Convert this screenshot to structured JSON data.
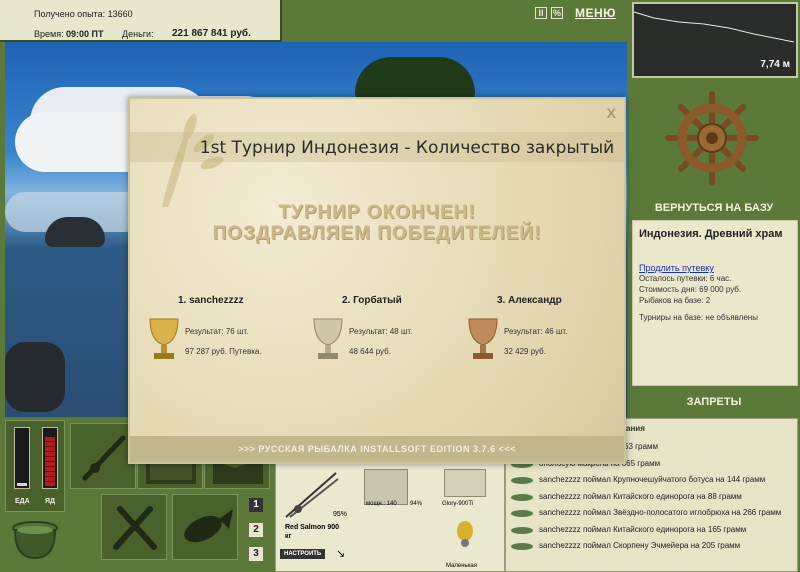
{
  "stats": {
    "experience_label": "Получено опыта:",
    "experience_value": "13660",
    "time_label": "Время:",
    "time_value": "09:00 ПТ",
    "money_label": "Деньги:",
    "money_value": "221 867 841 руб."
  },
  "toolbar": {
    "pause_icon": "pause-icon",
    "settings_icon": "settings-icon",
    "menu_label": "МЕНЮ"
  },
  "depth": {
    "value": "7,74 м"
  },
  "base": {
    "return_label": "ВЕРНУТЬСЯ НА БАЗУ",
    "location": "Индонезия. Древний храм",
    "extend_link": "Продлить путевку",
    "rows": [
      "Осталось путевки: 6 час.",
      "Стоимость дня: 69 000 руб.",
      "Рыбаков на базе: 2",
      "Турниры на базе: не объявлены"
    ],
    "bans_label": "ЗАПРЕТЫ"
  },
  "news": {
    "header": "ания",
    "items": [
      "ал Желтохвостого на 163 грамм",
      "ополосую макрель на 665 грамм",
      "sanchezzzz поймал Крупночешуйчатого ботуса на 144 грамм",
      "sanchezzzz поймал Китайского единорога на 88 грамм",
      "sanchezzzz поймал Звёздно-полосатого иглобрюха на 266 грамм",
      "sanchezzzz поймал Китайского единорога на 165 грамм",
      "sanchezzzz поймал Скорпену Эчмейера на 205 грамм"
    ]
  },
  "status": {
    "food_label": "ЕДА",
    "venom_label": "ЯД",
    "food_level": 0.05,
    "venom_level": 0.88
  },
  "slots": [
    "1",
    "2",
    "3"
  ],
  "tackle": {
    "rod_percent": "95%",
    "rod_name": "Red Salmon 900 кг",
    "setup_label": "НАСТРОИТЬ",
    "reel_power": "мощн.: 140",
    "reel_percent": "94%",
    "line_name": "Glory-900Ti",
    "lure_name": "Маленькая"
  },
  "modal": {
    "close_label": "X",
    "title": "1st Турнир Индонезия - Количество закрытый",
    "headline1": "ТУРНИР ОКОНЧЕН!",
    "headline2": "ПОЗДРАВЛЯЕМ ПОБЕДИТЕЛЕЙ!",
    "winners": [
      {
        "name": "1. sanchezzzz",
        "result": "Результат: 76 шт.",
        "money": "97 287 руб. Путевка."
      },
      {
        "name": "2. Горбатый",
        "result": "Результат: 48 шт.",
        "money": "48 644 руб."
      },
      {
        "name": "3. Александр",
        "result": "Результат: 46 шт.",
        "money": "32 429 руб."
      }
    ],
    "footer": ">>> РУССКАЯ РЫБАЛКА INSTALLSOFT EDITION 3.7.6 <<<"
  },
  "colors": {
    "panel_green": "#5b7a3a",
    "gold": "#d9b24a",
    "silver": "#c9c3a5",
    "bronze": "#c08a5a"
  }
}
